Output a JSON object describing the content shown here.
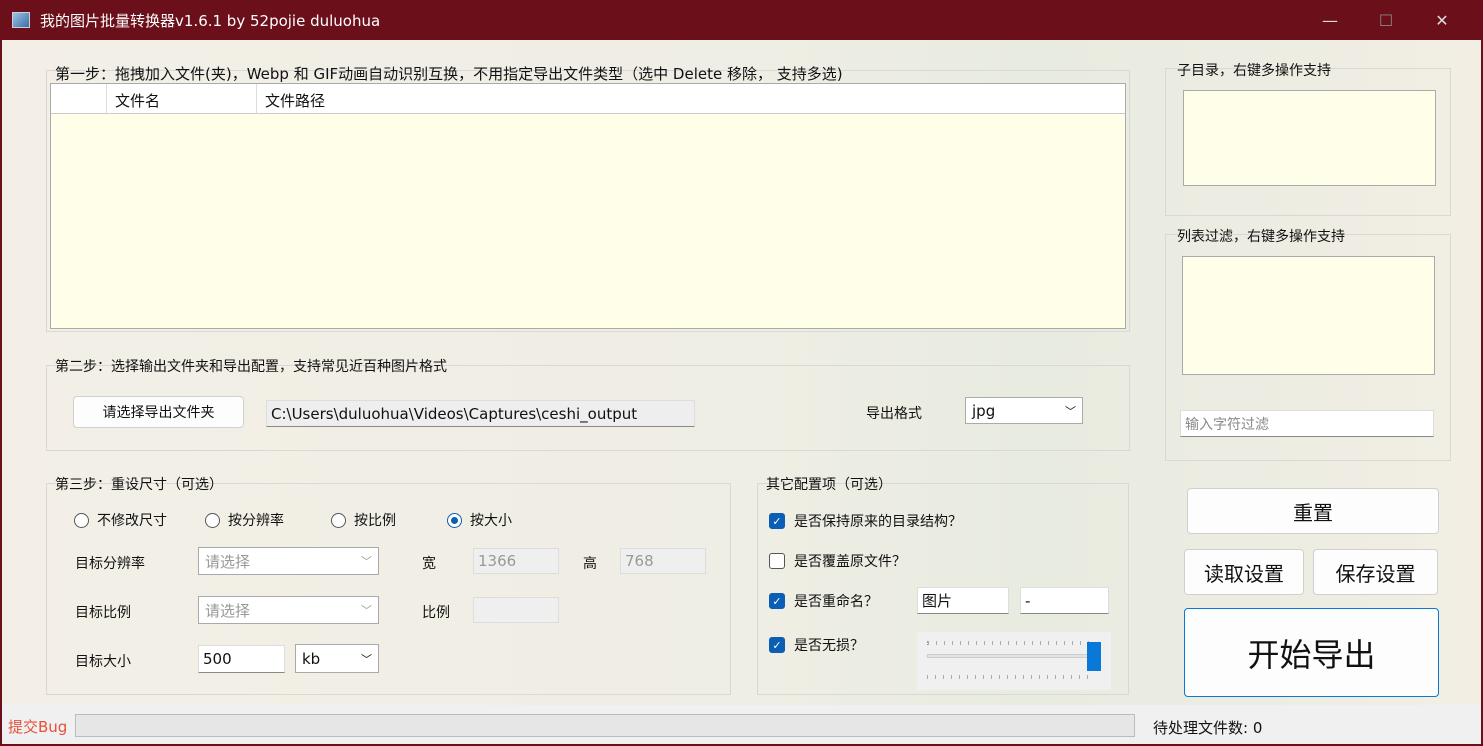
{
  "window": {
    "title": "我的图片批量转换器v1.6.1 by 52pojie duluohua",
    "minimize": "—",
    "maximize": "☐",
    "close": "✕"
  },
  "step1": {
    "label": "第一步：拖拽加入文件(夹)，Webp 和 GIF动画自动识别互换，不用指定导出文件类型（选中 Delete 移除， 支持多选)",
    "columns": [
      "",
      "文件名",
      "文件路径"
    ]
  },
  "step2": {
    "label": "第二步：选择输出文件夹和导出配置，支持常见近百种图片格式",
    "choose_folder": "请选择导出文件夹",
    "folder_path": "C:\\Users\\duluohua\\Videos\\Captures\\ceshi_output",
    "format_label": "导出格式",
    "format_value": "jpg"
  },
  "step3": {
    "label": "第三步：重设尺寸（可选）",
    "radios": [
      {
        "label": "不修改尺寸",
        "checked": false
      },
      {
        "label": "按分辨率",
        "checked": false
      },
      {
        "label": "按比例",
        "checked": false
      },
      {
        "label": "按大小",
        "checked": true
      }
    ],
    "resolution_label": "目标分辨率",
    "resolution_placeholder": "请选择",
    "width_label": "宽",
    "width_value": "1366",
    "height_label": "高",
    "height_value": "768",
    "ratio_label": "目标比例",
    "ratio_placeholder": "请选择",
    "ratio_field_label": "比例",
    "size_label": "目标大小",
    "size_value": "500",
    "size_unit": "kb"
  },
  "other": {
    "label": "其它配置项（可选）",
    "keep_structure": {
      "label": "是否保持原来的目录结构？",
      "checked": true
    },
    "overwrite": {
      "label": "是否覆盖原文件？",
      "checked": false
    },
    "rename": {
      "label": "是否重命名？",
      "checked": true,
      "prefix": "图片",
      "separator": "-"
    },
    "lossless": {
      "label": "是否无损？",
      "checked": true,
      "quality_slider_percent": 100
    }
  },
  "side": {
    "subdir_label": "子目录，右键多操作支持",
    "filter_label": "列表过滤，右键多操作支持",
    "filter_placeholder": "输入字符过滤"
  },
  "buttons": {
    "reset": "重置",
    "load": "读取设置",
    "save": "保存设置",
    "start": "开始导出"
  },
  "status": {
    "bug_link": "提交Bug",
    "pending": "待处理文件数: 0",
    "progress_percent": 0
  },
  "colors": {
    "titlebar": "#6b0f1a",
    "accent": "#0a5fb4",
    "bug": "#e8503a"
  }
}
